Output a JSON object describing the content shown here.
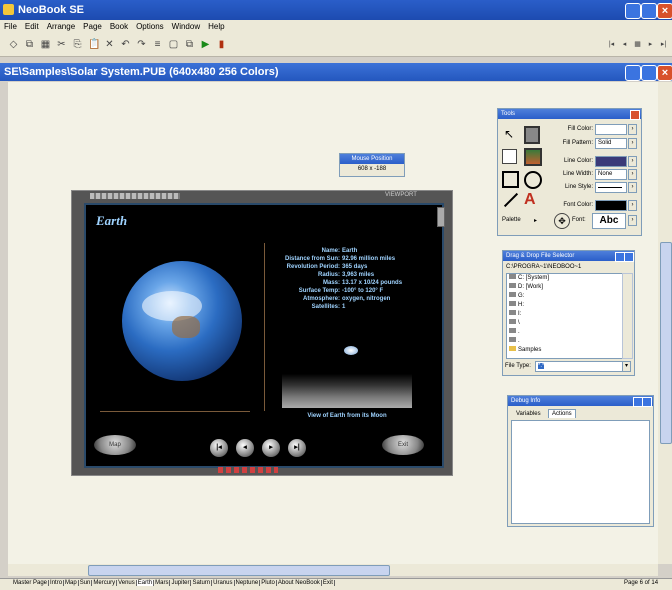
{
  "app": {
    "title": "NeoBook SE"
  },
  "menu": [
    "File",
    "Edit",
    "Arrange",
    "Page",
    "Book",
    "Options",
    "Window",
    "Help"
  ],
  "toolbar": {
    "left_icons": [
      "select-icon",
      "bring-front-icon",
      "group-icon",
      "scissors-icon",
      "copy-icon",
      "paste-icon",
      "delete-icon",
      "undo-icon",
      "redo-icon",
      "align-icon",
      "new-page-icon",
      "duplicate-page-icon",
      "play-icon",
      "exit-icon"
    ],
    "nav_icons": [
      "first-page-icon",
      "prev-page-icon",
      "page-list-icon",
      "next-page-icon",
      "last-page-icon"
    ],
    "nav_glyphs": [
      "|◂",
      "◂",
      "▦",
      "▸",
      "▸|"
    ]
  },
  "document": {
    "title": "SE\\Samples\\Solar System.PUB (640x480 256 Colors)"
  },
  "mouse_position": {
    "label": "Mouse Position",
    "value": "608 x -188"
  },
  "stage": {
    "planet_name": "Earth",
    "field_labels": [
      "Name:",
      "Distance from Sun:",
      "Revolution Period:",
      "Radius:",
      "Mass:",
      "Surface Temp:",
      "Atmosphere:",
      "Satellites:"
    ],
    "field_values": [
      "Earth",
      "92.96 million miles",
      "365 days",
      "3,963 miles",
      "13.17 x 10/24 pounds",
      "-100° to 120° F",
      "oxygen, nitrogen",
      "1"
    ],
    "photo_caption": "View of Earth from its Moon",
    "map_button": "Map",
    "exit_button": "Exit",
    "nav_glyphs": [
      "|◂",
      "◂",
      "▸",
      "▸|"
    ],
    "viewport_label": "VIEWPORT"
  },
  "tools": {
    "title": "Tools",
    "fill_color_label": "Fill Color:",
    "fill_pattern_label": "Fill Pattern:",
    "fill_pattern_value": "Solid",
    "line_color_label": "Line Color:",
    "line_width_label": "Line Width:",
    "line_width_value": "None",
    "line_style_label": "Line Style:",
    "font_color_label": "Font Color:",
    "font_label": "Font:",
    "font_sample": "Abc",
    "palette_label": "Palette",
    "colors": {
      "fill": "#ffffff",
      "line": "#3a3a78",
      "font": "#000000"
    }
  },
  "file_selector": {
    "title": "Drag & Drop File Selector",
    "path": "C:\\PROGRA~1\\NEOBOO~1",
    "items": [
      "C: [System]",
      "D: [Work]",
      "G:",
      "H:",
      "I:",
      "\\",
      ".",
      ".",
      "Samples"
    ],
    "file_type_label": "File Type:",
    "file_type_value": "*.*"
  },
  "debug": {
    "title": "Debug Info",
    "tabs": [
      "Variables",
      "Actions"
    ]
  },
  "page_tabs": [
    "Master Page",
    "Intro",
    "Map",
    "Sun",
    "Mercury",
    "Venus",
    "Earth",
    "Mars",
    "Jupiter",
    "Saturn",
    "Uranus",
    "Neptune",
    "Pluto",
    "About NeoBook",
    "Exit"
  ],
  "status": {
    "page": "Page 6 of 14"
  }
}
